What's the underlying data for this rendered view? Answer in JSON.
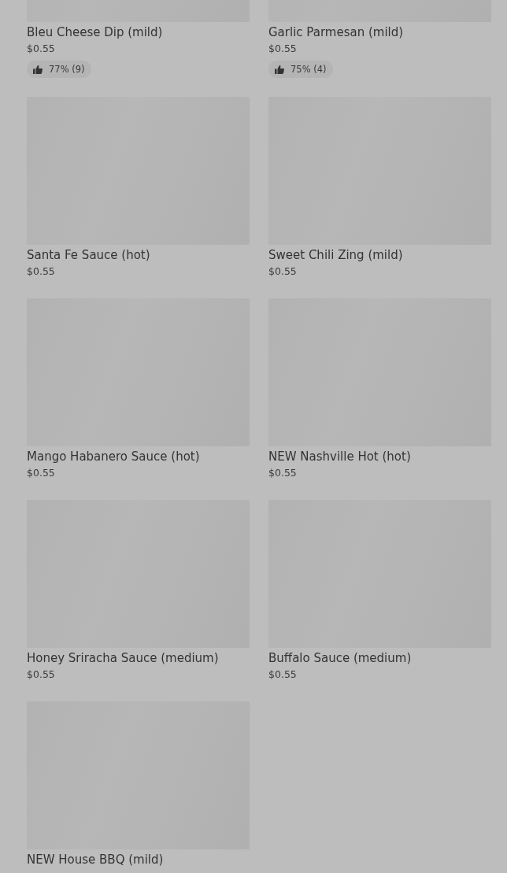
{
  "items": [
    {
      "name": "Bleu Cheese Dip (mild)",
      "price": "$0.55",
      "rating": "77% (9)"
    },
    {
      "name": "Garlic Parmesan (mild)",
      "price": "$0.55",
      "rating": "75% (4)"
    },
    {
      "name": "Santa Fe Sauce (hot)",
      "price": "$0.55"
    },
    {
      "name": "Sweet Chili Zing (mild)",
      "price": "$0.55"
    },
    {
      "name": "Mango Habanero Sauce (hot)",
      "price": "$0.55"
    },
    {
      "name": "NEW Nashville Hot (hot)",
      "price": "$0.55"
    },
    {
      "name": "Honey Sriracha Sauce (medium)",
      "price": "$0.55"
    },
    {
      "name": "Buffalo Sauce (medium)",
      "price": "$0.55"
    },
    {
      "name": "NEW House BBQ (mild)"
    }
  ]
}
